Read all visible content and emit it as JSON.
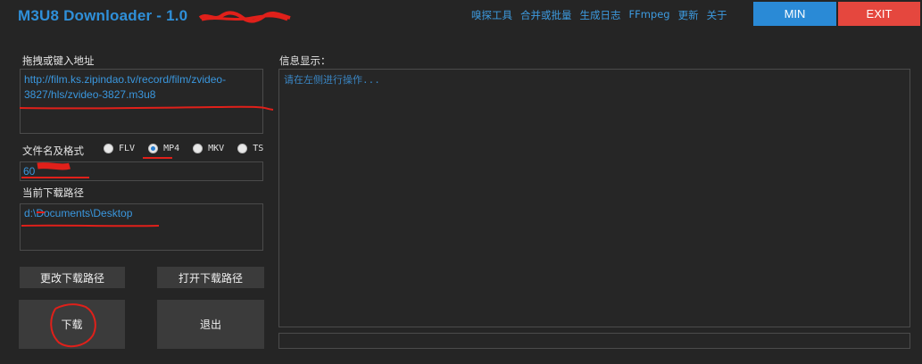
{
  "app": {
    "title": "M3U8 Downloader - 1.0"
  },
  "topmenu": [
    {
      "label": "嗅探工具"
    },
    {
      "label": "合并或批量"
    },
    {
      "label": "生成日志"
    },
    {
      "label": "FFmpeg"
    },
    {
      "label": "更新"
    },
    {
      "label": "关于"
    }
  ],
  "window": {
    "min_label": "MIN",
    "exit_label": "EXIT"
  },
  "url": {
    "label": "拖拽或键入地址",
    "value": "http://film.ks.zipindao.tv/record/film/zvideo-3827/hls/zvideo-3827.m3u8"
  },
  "filename": {
    "label": "文件名及格式",
    "value": "60",
    "formats": [
      "FLV",
      "MP4",
      "MKV",
      "TS"
    ],
    "selected": "MP4"
  },
  "path": {
    "label": "当前下载路径",
    "value": "d:\\Documents\\Desktop"
  },
  "info": {
    "label": "信息显示：",
    "message": "请在左侧进行操作..."
  },
  "buttons": {
    "change_path": "更改下载路径",
    "open_path": "打开下载路径",
    "download": "下载",
    "quit": "退出"
  },
  "colors": {
    "accent": "#2a8ad6",
    "exit": "#e5473e",
    "background": "#252525",
    "text_blue": "#3a97de",
    "annotation": "#e0201a"
  }
}
